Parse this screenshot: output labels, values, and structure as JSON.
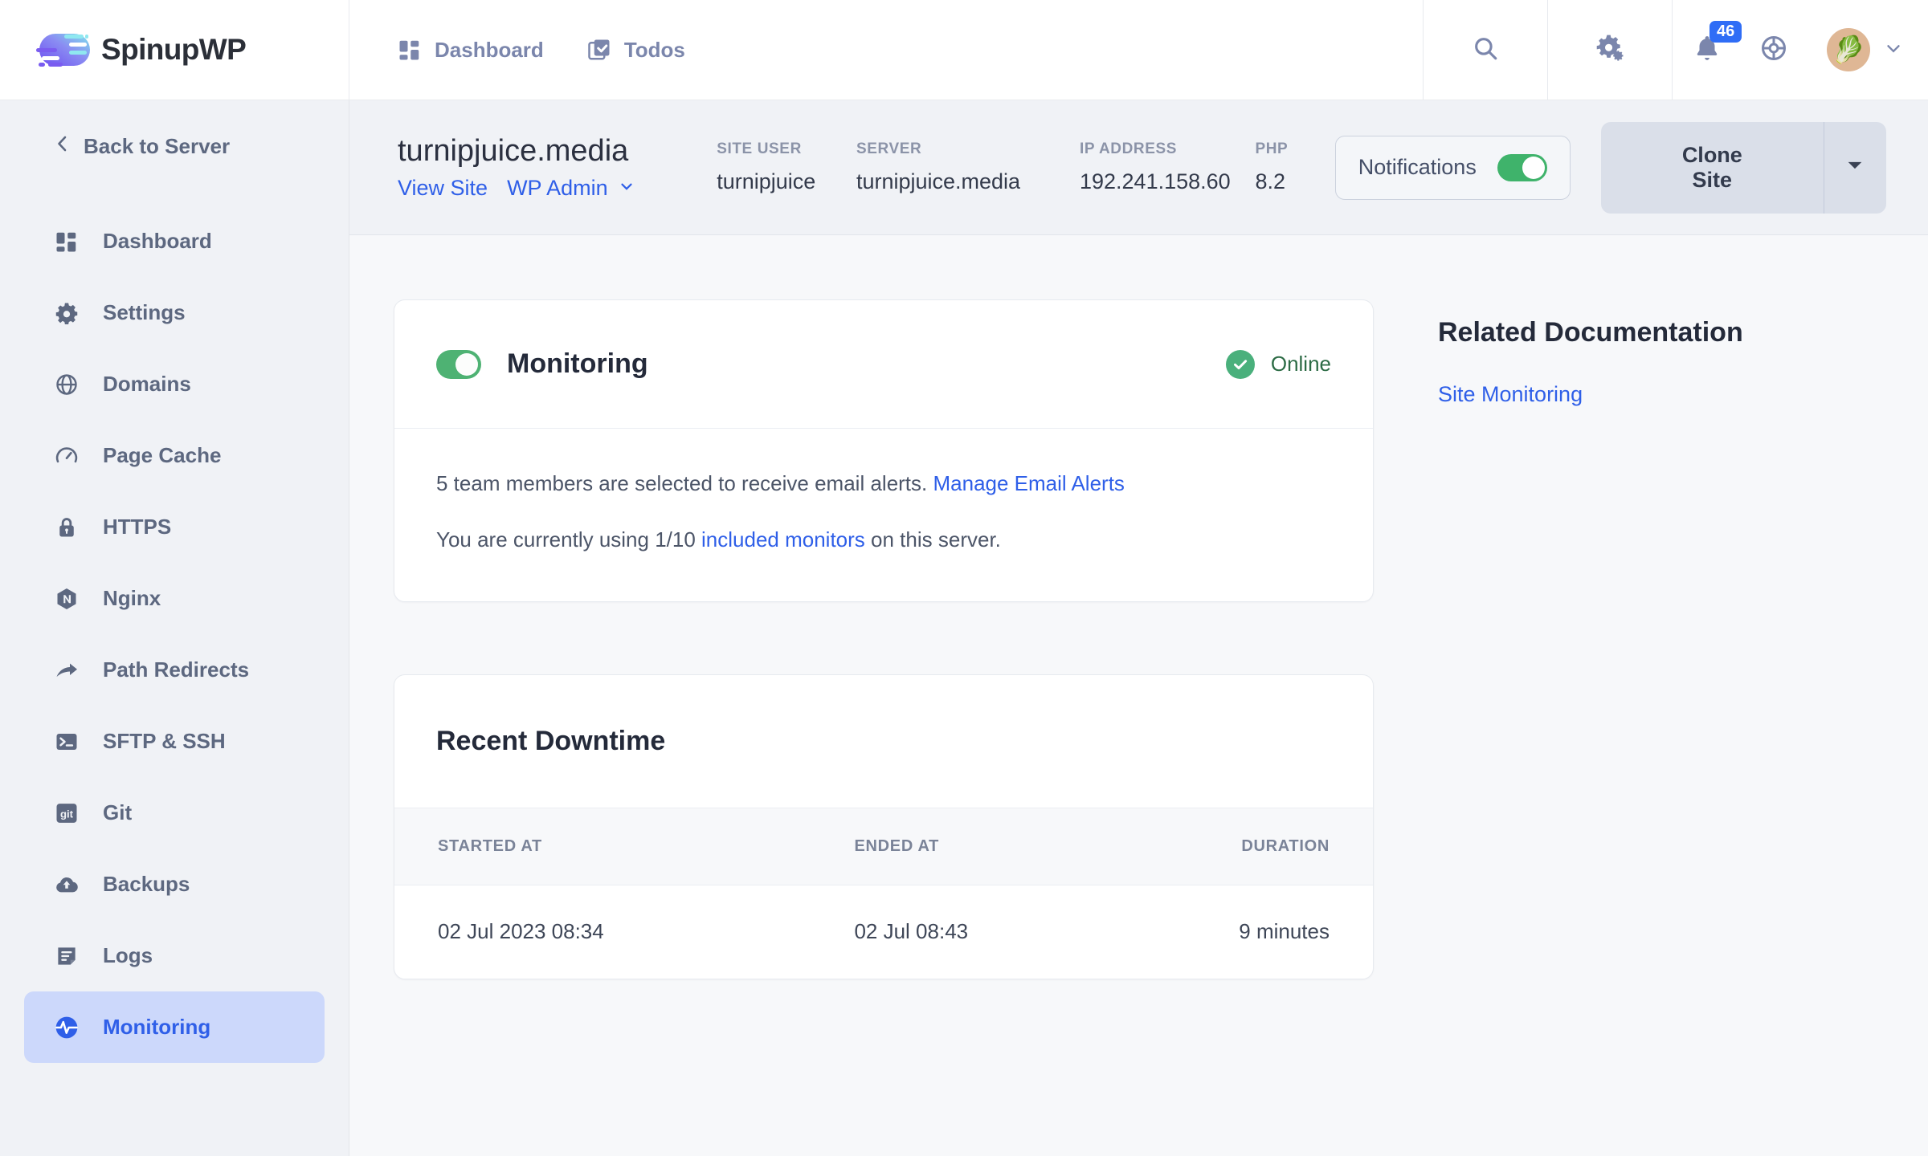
{
  "brand": {
    "name": "SpinupWP",
    "logo_icon": "spinupwp-logo-icon"
  },
  "topnav": {
    "items": [
      {
        "label": "Dashboard",
        "icon": "dashboard-grid-icon"
      },
      {
        "label": "Todos",
        "icon": "checkbox-todos-icon"
      }
    ],
    "search_icon": "search-icon",
    "settings_icon": "gears-icon",
    "notifications_icon": "bell-icon",
    "notifications_count": "46",
    "support_icon": "lifebuoy-icon",
    "avatar_icon": "beet-avatar",
    "account_caret_icon": "chevron-down-icon"
  },
  "sidebar": {
    "back_label": "Back to Server",
    "back_icon": "chevron-left-icon",
    "items": [
      {
        "label": "Dashboard",
        "icon": "dashboard-grid-icon",
        "active": false
      },
      {
        "label": "Settings",
        "icon": "gear-icon",
        "active": false
      },
      {
        "label": "Domains",
        "icon": "globe-icon",
        "active": false
      },
      {
        "label": "Page Cache",
        "icon": "gauge-icon",
        "active": false
      },
      {
        "label": "HTTPS",
        "icon": "lock-icon",
        "active": false
      },
      {
        "label": "Nginx",
        "icon": "nginx-icon",
        "active": false
      },
      {
        "label": "Path Redirects",
        "icon": "arrow-redirect-icon",
        "active": false
      },
      {
        "label": "SFTP & SSH",
        "icon": "terminal-icon",
        "active": false
      },
      {
        "label": "Git",
        "icon": "git-icon",
        "active": false
      },
      {
        "label": "Backups",
        "icon": "cloud-upload-icon",
        "active": false
      },
      {
        "label": "Logs",
        "icon": "document-lines-icon",
        "active": false
      },
      {
        "label": "Monitoring",
        "icon": "pulse-circle-icon",
        "active": true
      }
    ]
  },
  "site_header": {
    "title": "turnipjuice.media",
    "view_site_label": "View Site",
    "wp_admin_label": "WP Admin",
    "wp_admin_caret_icon": "chevron-down-icon",
    "meta": [
      {
        "label": "SITE USER",
        "value": "turnipjuice"
      },
      {
        "label": "SERVER",
        "value": "turnipjuice.media"
      },
      {
        "label": "IP ADDRESS",
        "value": "192.241.158.60"
      },
      {
        "label": "PHP",
        "value": "8.2"
      }
    ],
    "notifications_label": "Notifications",
    "notifications_enabled": true,
    "clone_site_label": "Clone Site",
    "clone_caret_icon": "caret-down-icon"
  },
  "monitoring_card": {
    "toggle_enabled": true,
    "title": "Monitoring",
    "status_label": "Online",
    "status_icon": "check-circle-icon",
    "status_color": "#4ab07c",
    "line1_prefix": "5 team members are selected to receive email alerts. ",
    "line1_link": "Manage Email Alerts",
    "line2_prefix": "You are currently using 1/10 ",
    "line2_link": "included monitors",
    "line2_suffix": " on this server."
  },
  "downtime_card": {
    "title": "Recent Downtime",
    "columns": [
      "STARTED AT",
      "ENDED AT",
      "DURATION"
    ],
    "rows": [
      {
        "started_at": "02 Jul 2023 08:34",
        "ended_at": "02 Jul 08:43",
        "duration": "9 minutes"
      }
    ]
  },
  "related_docs": {
    "title": "Related Documentation",
    "links": [
      {
        "label": "Site Monitoring"
      }
    ]
  },
  "colors": {
    "accent_blue": "#2f5fe8",
    "active_nav_bg": "#ccd8fb",
    "toggle_green": "#4eb273",
    "badge_blue": "#2f6df6",
    "page_bg": "#f7f8fa",
    "sidebar_bg": "#f0f2f6"
  }
}
